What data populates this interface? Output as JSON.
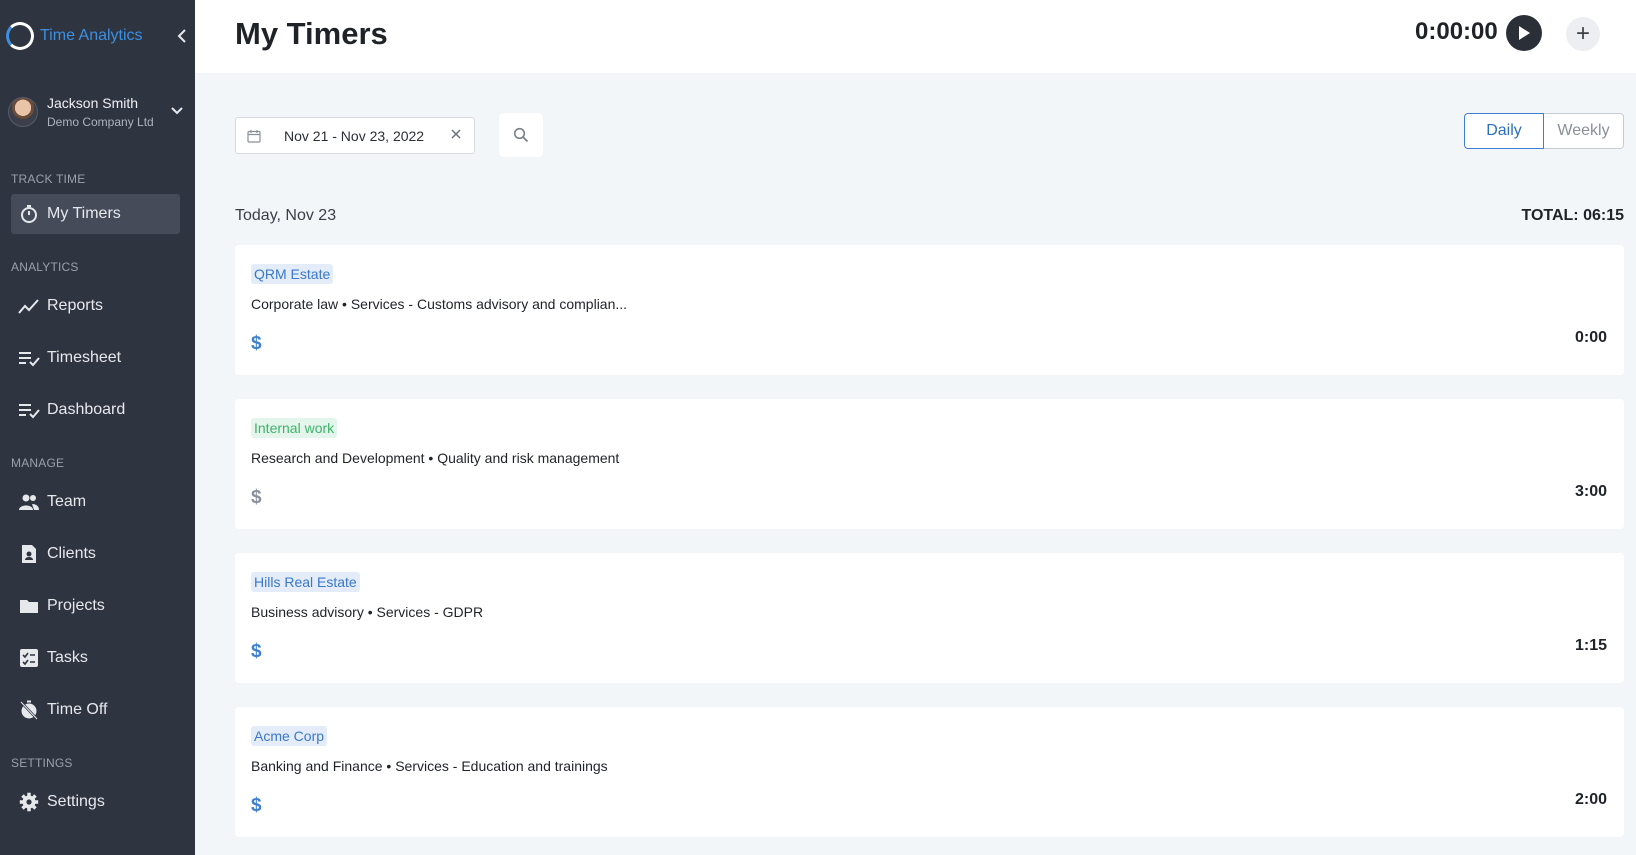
{
  "app": {
    "brand_name": "Time Analytics",
    "accent_color": "#3d8fe0"
  },
  "user": {
    "name": "Jackson Smith",
    "company": "Demo Company Ltd"
  },
  "sidebar": {
    "sections": {
      "track_time": "TRACK TIME",
      "analytics": "ANALYTICS",
      "manage": "MANAGE",
      "settings": "SETTINGS"
    },
    "items": {
      "my_timers": "My Timers",
      "reports": "Reports",
      "timesheet": "Timesheet",
      "dashboard": "Dashboard",
      "team": "Team",
      "clients": "Clients",
      "projects": "Projects",
      "tasks": "Tasks",
      "time_off": "Time Off",
      "settings": "Settings"
    }
  },
  "header": {
    "title": "My Timers",
    "timer": "0:00:00",
    "add_label": "+"
  },
  "filters": {
    "date_range": "Nov 21 - Nov 23, 2022",
    "view_daily": "Daily",
    "view_weekly": "Weekly",
    "active_view": "Daily"
  },
  "day": {
    "label": "Today, Nov 23",
    "total": "TOTAL: 06:15"
  },
  "timers": [
    {
      "client": "QRM Estate",
      "tag_color": "blue",
      "task": "Corporate law • Services - Customs advisory and complian...",
      "billable_symbol": "$",
      "billable": true,
      "duration": "0:00"
    },
    {
      "client": "Internal work",
      "tag_color": "green",
      "task": "Research and Development • Quality and risk management",
      "billable_symbol": "$",
      "billable": false,
      "duration": "3:00"
    },
    {
      "client": "Hills Real Estate",
      "tag_color": "blue",
      "task": "Business advisory • Services - GDPR",
      "billable_symbol": "$",
      "billable": true,
      "duration": "1:15"
    },
    {
      "client": "Acme Corp",
      "tag_color": "blue",
      "task": "Banking and Finance • Services - Education and trainings",
      "billable_symbol": "$",
      "billable": true,
      "duration": "2:00"
    }
  ]
}
